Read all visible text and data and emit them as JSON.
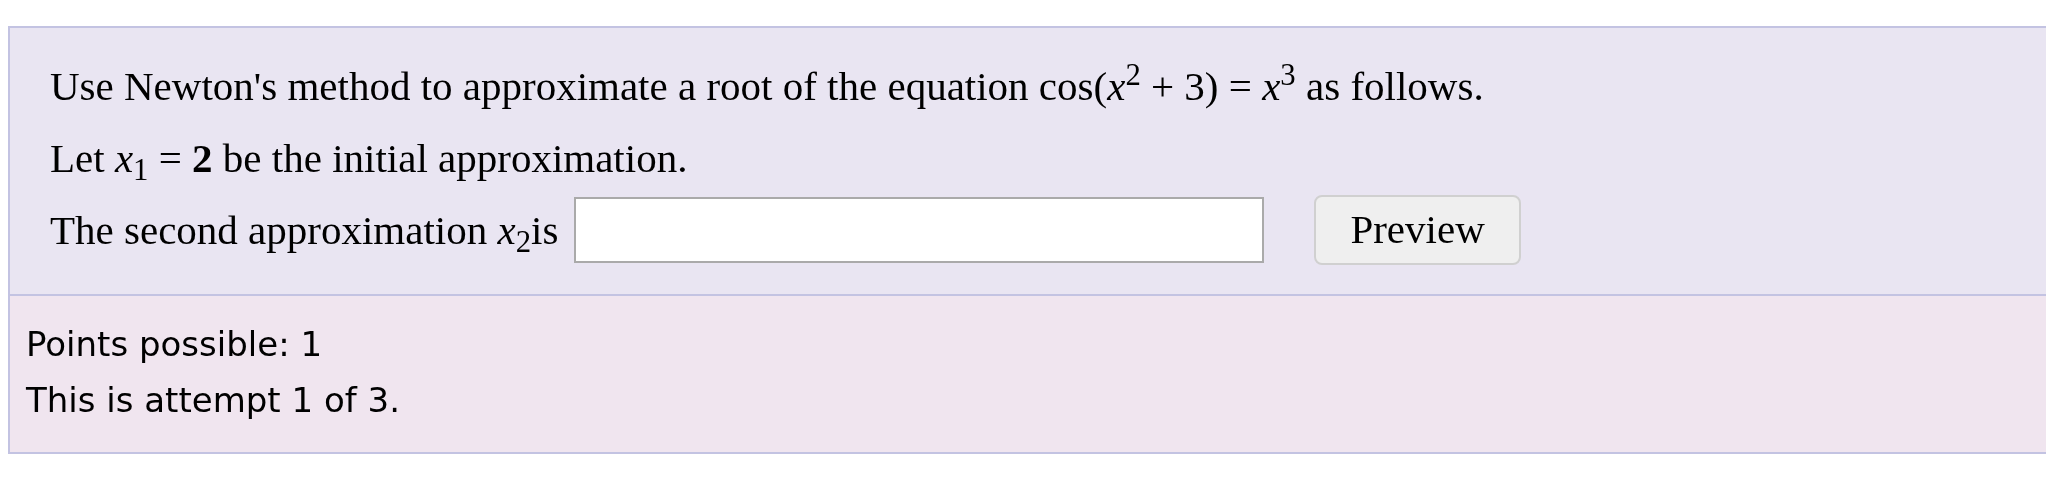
{
  "question": {
    "lines": [
      "Use Newton's method to approximate a root of the equation cos(*x*$^{2}$ + 3) = *x*$^{3}$ as follows.",
      "Let *x*$_{1}$ = **2** be the initial approximation."
    ],
    "answer": {
      "label": "The second approximation *x*$_{2}$is",
      "button": "Preview"
    }
  },
  "footer": [
    "Points possible: 1",
    "This is attempt 1 of 3."
  ]
}
